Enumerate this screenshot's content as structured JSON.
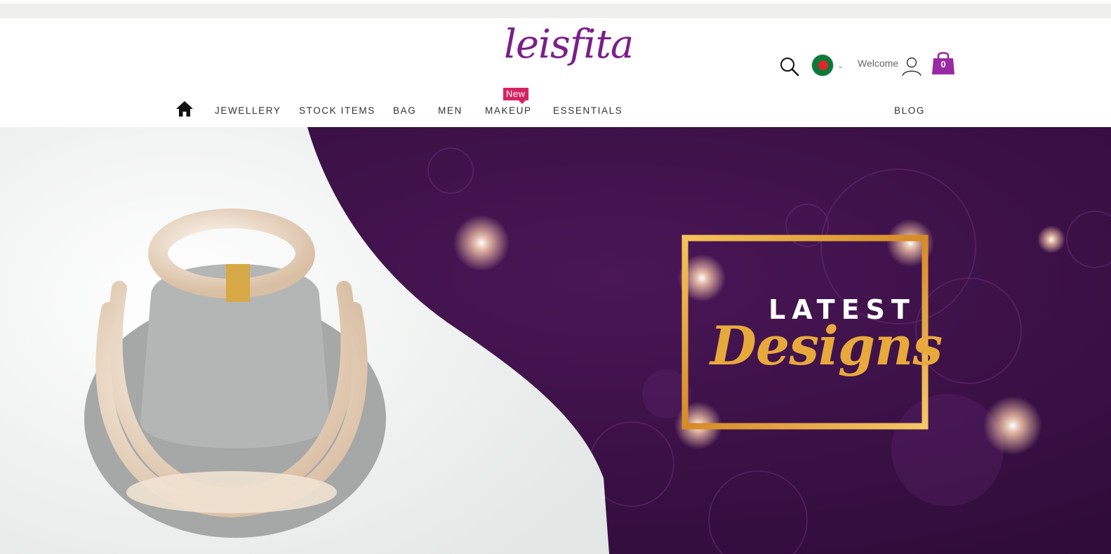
{
  "brand": {
    "logo_text": "leisfita"
  },
  "header": {
    "welcome_label": "Welcome",
    "cart_count": "0",
    "icons": {
      "search": "search-icon",
      "flag": "bangladesh-flag-icon",
      "user": "user-icon",
      "cart": "shopping-bag-icon",
      "home": "home-icon"
    }
  },
  "nav": {
    "items": [
      {
        "label": "JEWELLERY"
      },
      {
        "label": "STOCK ITEMS"
      },
      {
        "label": "BAG"
      },
      {
        "label": "MEN"
      },
      {
        "label": "MAKEUP",
        "badge": "New"
      },
      {
        "label": "ESSENTIALS"
      },
      {
        "label": "BLOG"
      }
    ]
  },
  "hero": {
    "headline_line1": "LATEST",
    "headline_line2": "Designs"
  },
  "colors": {
    "brand_purple": "#7b1f8a",
    "hero_purple": "#3c1147",
    "gold": "#e7a93b",
    "badge_pink": "#d6245f"
  }
}
